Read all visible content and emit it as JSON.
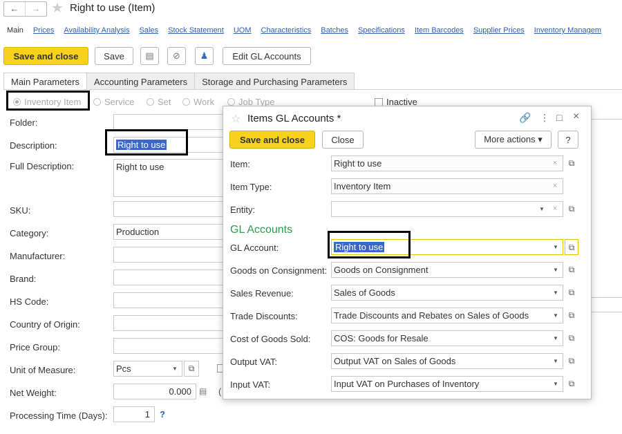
{
  "header": {
    "back_icon": "←",
    "forward_icon": "→",
    "star_icon": "★",
    "title": "Right to use (Item)"
  },
  "links": {
    "current": "Main",
    "items": [
      "Prices",
      "Availability Analysis",
      "Sales",
      "Stock Statement",
      "UOM",
      "Characteristics",
      "Batches",
      "Specifications",
      "Item Barcodes",
      "Supplier Prices",
      "Inventory Managem"
    ]
  },
  "toolbar": {
    "save_close": "Save and close",
    "save": "Save",
    "list_icon": "▤",
    "clip_icon": "⊘",
    "bell_icon": "♟",
    "edit_gl": "Edit GL Accounts"
  },
  "tabs": [
    "Main Parameters",
    "Accounting Parameters",
    "Storage and Purchasing Parameters"
  ],
  "types": [
    "Inventory Item",
    "Service",
    "Set",
    "Work",
    "Job Type"
  ],
  "inactive": "Inactive",
  "form": {
    "folder": "Folder:",
    "description": "Description:",
    "description_value": "Right to use",
    "full_description": "Full Description:",
    "full_description_value": "Right to use",
    "sku": "SKU:",
    "category": "Category:",
    "category_value": "Production",
    "manufacturer": "Manufacturer:",
    "brand": "Brand:",
    "hs_code": "HS Code:",
    "country": "Country of Origin:",
    "price_group": "Price Group:",
    "uom": "Unit of Measure:",
    "uom_value": "Pcs",
    "net_weight": "Net Weight:",
    "net_weight_value": "0.000",
    "processing": "Processing Time (Days):",
    "processing_value": "1",
    "help": "?"
  },
  "dialog": {
    "star": "☆",
    "title": "Items GL Accounts *",
    "link_icon": "🔗",
    "more_icon": "⋮",
    "max_icon": "□",
    "close_icon": "×",
    "save_close": "Save and close",
    "close": "Close",
    "more_actions": "More actions ▾",
    "help": "?",
    "item": "Item:",
    "item_value": "Right to use",
    "item_type": "Item Type:",
    "item_type_value": "Inventory Item",
    "entity": "Entity:",
    "entity_value": "",
    "section": "GL Accounts",
    "rows": [
      {
        "label": "GL Account:",
        "value": "Right to use"
      },
      {
        "label": "Goods on Consignment:",
        "value": "Goods on Consignment"
      },
      {
        "label": "Sales Revenue:",
        "value": "Sales of Goods"
      },
      {
        "label": "Trade Discounts:",
        "value": "Trade Discounts and Rebates on Sales of Goods"
      },
      {
        "label": "Cost of Goods Sold:",
        "value": "COS: Goods for Resale"
      },
      {
        "label": "Output VAT:",
        "value": "Output VAT on Sales of Goods"
      },
      {
        "label": "Input VAT:",
        "value": "Input VAT on Purchases of Inventory"
      }
    ]
  },
  "icons": {
    "dropdown": "▼",
    "open": "⧉",
    "clear": "×"
  }
}
